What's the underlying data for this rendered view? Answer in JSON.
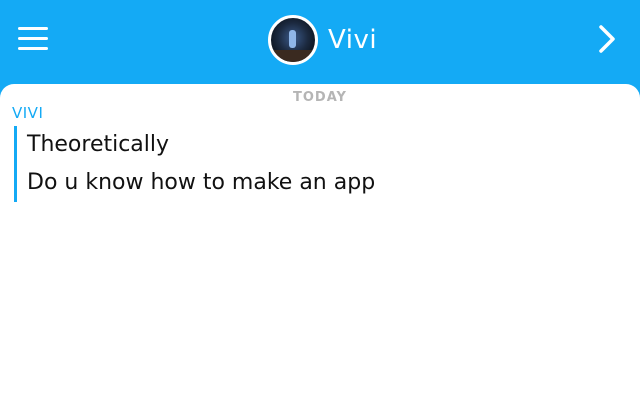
{
  "header": {
    "menu_icon": "hamburger-menu-icon",
    "title": "Vivi",
    "avatar_icon": "profile-avatar",
    "forward_icon": "chevron-right-icon",
    "background_color": "#14aaf5"
  },
  "chat": {
    "date_label": "TODAY",
    "sender": "VIVI",
    "sender_color": "#14aaf5",
    "messages": [
      {
        "text": "Theoretically"
      },
      {
        "text": "Do u know how to make an app"
      }
    ]
  }
}
